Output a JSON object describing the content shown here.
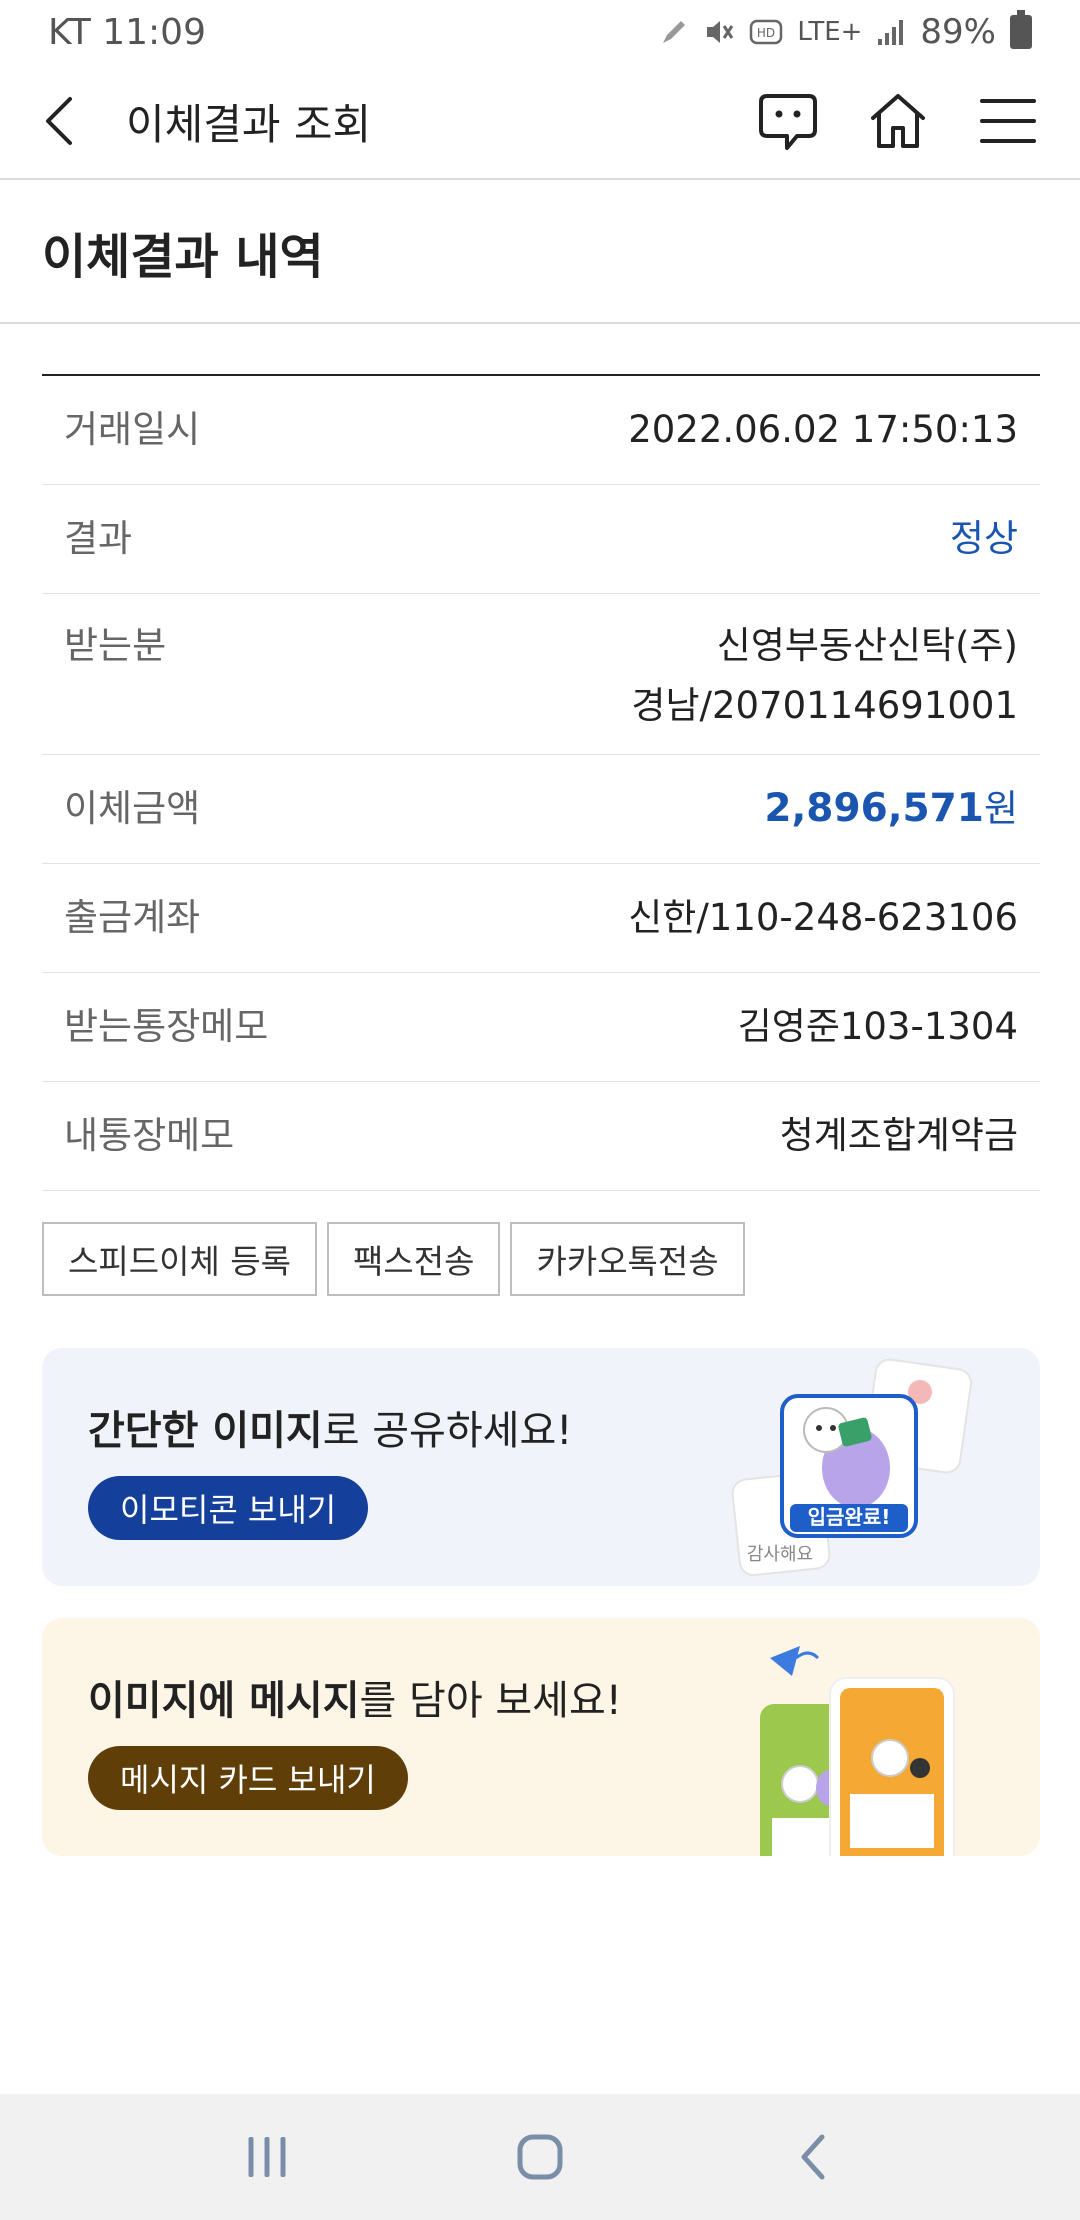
{
  "status_bar": {
    "carrier_time": "KT 11:09",
    "network": "LTE+",
    "battery": "89%"
  },
  "header": {
    "title": "이체결과 조회",
    "icons": [
      "back-icon",
      "chat-icon",
      "home-icon",
      "menu-icon"
    ]
  },
  "page_title": "이체결과 내역",
  "details": {
    "datetime": {
      "label": "거래일시",
      "value": "2022.06.02 17:50:13"
    },
    "result": {
      "label": "결과",
      "value": "정상"
    },
    "recipient": {
      "label": "받는분",
      "value_line1": "신영부동산신탁(주)",
      "value_line2": "경남/2070114691001"
    },
    "amount": {
      "label": "이체금액",
      "value": "2,896,571",
      "unit": "원"
    },
    "from_account": {
      "label": "출금계좌",
      "value": "신한/110-248-623106"
    },
    "recipient_memo": {
      "label": "받는통장메모",
      "value": "김영준103-1304"
    },
    "my_memo": {
      "label": "내통장메모",
      "value": "청계조합계약금"
    }
  },
  "actions": {
    "speed_transfer": "스피드이체 등록",
    "fax": "팩스전송",
    "kakao": "카카오톡전송"
  },
  "promo_emoticon": {
    "bold1": "간단한 이미지",
    "rest": "로 공유하세요!",
    "button": "이모티콘 보내기",
    "art_label": "입금완료!",
    "art_sub": "감사해요"
  },
  "promo_card": {
    "bold1": "이미지에 메시지",
    "rest": "를 담아 보세요!",
    "button": "메시지 카드 보내기"
  },
  "colors": {
    "accent_blue": "#1a56b0",
    "promo_blue_btn": "#14409c",
    "promo_brown_btn": "#5f3e08"
  }
}
